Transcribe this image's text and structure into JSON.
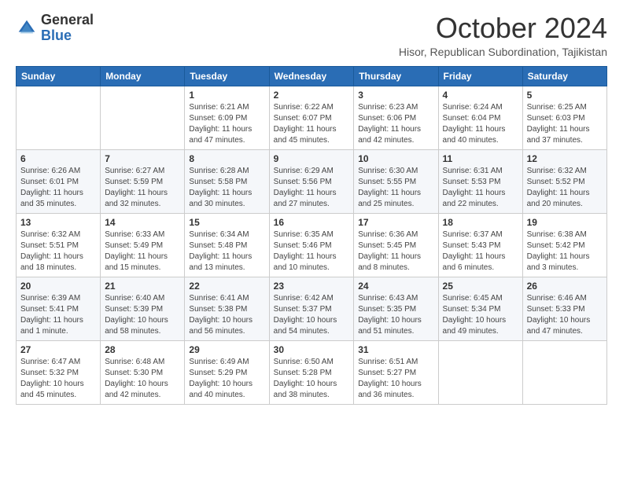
{
  "header": {
    "logo_general": "General",
    "logo_blue": "Blue",
    "month_title": "October 2024",
    "subtitle": "Hisor, Republican Subordination, Tajikistan"
  },
  "weekdays": [
    "Sunday",
    "Monday",
    "Tuesday",
    "Wednesday",
    "Thursday",
    "Friday",
    "Saturday"
  ],
  "weeks": [
    [
      {
        "day": "",
        "info": ""
      },
      {
        "day": "",
        "info": ""
      },
      {
        "day": "1",
        "info": "Sunrise: 6:21 AM\nSunset: 6:09 PM\nDaylight: 11 hours and 47 minutes."
      },
      {
        "day": "2",
        "info": "Sunrise: 6:22 AM\nSunset: 6:07 PM\nDaylight: 11 hours and 45 minutes."
      },
      {
        "day": "3",
        "info": "Sunrise: 6:23 AM\nSunset: 6:06 PM\nDaylight: 11 hours and 42 minutes."
      },
      {
        "day": "4",
        "info": "Sunrise: 6:24 AM\nSunset: 6:04 PM\nDaylight: 11 hours and 40 minutes."
      },
      {
        "day": "5",
        "info": "Sunrise: 6:25 AM\nSunset: 6:03 PM\nDaylight: 11 hours and 37 minutes."
      }
    ],
    [
      {
        "day": "6",
        "info": "Sunrise: 6:26 AM\nSunset: 6:01 PM\nDaylight: 11 hours and 35 minutes."
      },
      {
        "day": "7",
        "info": "Sunrise: 6:27 AM\nSunset: 5:59 PM\nDaylight: 11 hours and 32 minutes."
      },
      {
        "day": "8",
        "info": "Sunrise: 6:28 AM\nSunset: 5:58 PM\nDaylight: 11 hours and 30 minutes."
      },
      {
        "day": "9",
        "info": "Sunrise: 6:29 AM\nSunset: 5:56 PM\nDaylight: 11 hours and 27 minutes."
      },
      {
        "day": "10",
        "info": "Sunrise: 6:30 AM\nSunset: 5:55 PM\nDaylight: 11 hours and 25 minutes."
      },
      {
        "day": "11",
        "info": "Sunrise: 6:31 AM\nSunset: 5:53 PM\nDaylight: 11 hours and 22 minutes."
      },
      {
        "day": "12",
        "info": "Sunrise: 6:32 AM\nSunset: 5:52 PM\nDaylight: 11 hours and 20 minutes."
      }
    ],
    [
      {
        "day": "13",
        "info": "Sunrise: 6:32 AM\nSunset: 5:51 PM\nDaylight: 11 hours and 18 minutes."
      },
      {
        "day": "14",
        "info": "Sunrise: 6:33 AM\nSunset: 5:49 PM\nDaylight: 11 hours and 15 minutes."
      },
      {
        "day": "15",
        "info": "Sunrise: 6:34 AM\nSunset: 5:48 PM\nDaylight: 11 hours and 13 minutes."
      },
      {
        "day": "16",
        "info": "Sunrise: 6:35 AM\nSunset: 5:46 PM\nDaylight: 11 hours and 10 minutes."
      },
      {
        "day": "17",
        "info": "Sunrise: 6:36 AM\nSunset: 5:45 PM\nDaylight: 11 hours and 8 minutes."
      },
      {
        "day": "18",
        "info": "Sunrise: 6:37 AM\nSunset: 5:43 PM\nDaylight: 11 hours and 6 minutes."
      },
      {
        "day": "19",
        "info": "Sunrise: 6:38 AM\nSunset: 5:42 PM\nDaylight: 11 hours and 3 minutes."
      }
    ],
    [
      {
        "day": "20",
        "info": "Sunrise: 6:39 AM\nSunset: 5:41 PM\nDaylight: 11 hours and 1 minute."
      },
      {
        "day": "21",
        "info": "Sunrise: 6:40 AM\nSunset: 5:39 PM\nDaylight: 10 hours and 58 minutes."
      },
      {
        "day": "22",
        "info": "Sunrise: 6:41 AM\nSunset: 5:38 PM\nDaylight: 10 hours and 56 minutes."
      },
      {
        "day": "23",
        "info": "Sunrise: 6:42 AM\nSunset: 5:37 PM\nDaylight: 10 hours and 54 minutes."
      },
      {
        "day": "24",
        "info": "Sunrise: 6:43 AM\nSunset: 5:35 PM\nDaylight: 10 hours and 51 minutes."
      },
      {
        "day": "25",
        "info": "Sunrise: 6:45 AM\nSunset: 5:34 PM\nDaylight: 10 hours and 49 minutes."
      },
      {
        "day": "26",
        "info": "Sunrise: 6:46 AM\nSunset: 5:33 PM\nDaylight: 10 hours and 47 minutes."
      }
    ],
    [
      {
        "day": "27",
        "info": "Sunrise: 6:47 AM\nSunset: 5:32 PM\nDaylight: 10 hours and 45 minutes."
      },
      {
        "day": "28",
        "info": "Sunrise: 6:48 AM\nSunset: 5:30 PM\nDaylight: 10 hours and 42 minutes."
      },
      {
        "day": "29",
        "info": "Sunrise: 6:49 AM\nSunset: 5:29 PM\nDaylight: 10 hours and 40 minutes."
      },
      {
        "day": "30",
        "info": "Sunrise: 6:50 AM\nSunset: 5:28 PM\nDaylight: 10 hours and 38 minutes."
      },
      {
        "day": "31",
        "info": "Sunrise: 6:51 AM\nSunset: 5:27 PM\nDaylight: 10 hours and 36 minutes."
      },
      {
        "day": "",
        "info": ""
      },
      {
        "day": "",
        "info": ""
      }
    ]
  ]
}
